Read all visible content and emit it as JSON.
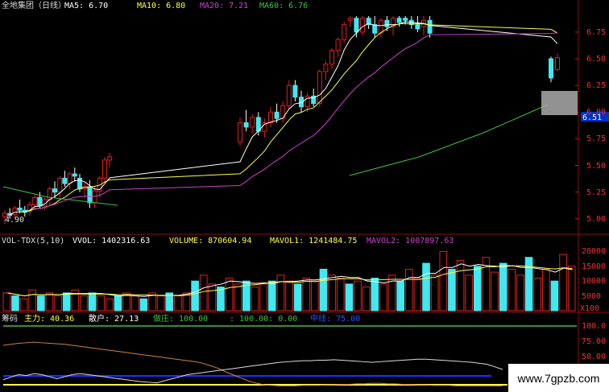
{
  "app": {
    "title": "全地集团（日线）",
    "colors": {
      "up": "#e02020",
      "down": "#40e8f0",
      "ma5": "#ffffff",
      "ma10": "#ffff40",
      "ma20": "#d040d0",
      "ma60": "#40c040",
      "axis": "#c02020"
    }
  },
  "price_panel": {
    "ma5": "MA5: 6.70",
    "ma10": "MA10: 6.80",
    "ma20": "MA20: 7.21",
    "ma60": "MA60: 6.76",
    "ticks": [
      "6.75",
      "6.50",
      "6.25",
      "6.00",
      "5.75",
      "5.50",
      "5.25",
      "5.00"
    ],
    "current_price": "6.51",
    "low_marker": "4.90"
  },
  "volume_panel": {
    "header": "VOL-TDX(5,10)",
    "vvol": "VVOL: 1402316.63",
    "volume": "VOLUME: 870604.94",
    "mavol1": "MAVOL1: 1241484.75",
    "mavol2": "MAVOL2: 1007897.63",
    "ticks": [
      "20000",
      "15000",
      "10000",
      "5000"
    ],
    "unit": "X100"
  },
  "indicator_panel": {
    "name": "筹码",
    "zhuli": "主力: 40.36",
    "sanhu": "散户: 27.13",
    "zhuang": "做庄: 100.00",
    "value": ": 100.00: 0.00",
    "zhongxian": "中线: 75.00",
    "ticks": [
      "100.0",
      "75.00",
      "50.00"
    ]
  },
  "watermark": "www.7gpzb.com",
  "chart_data": {
    "type": "candlestick",
    "ylim": [
      4.9,
      6.9
    ],
    "candles": [
      {
        "o": 5.02,
        "h": 5.08,
        "l": 4.95,
        "c": 5.05
      },
      {
        "o": 5.05,
        "h": 5.1,
        "l": 5.0,
        "c": 5.03
      },
      {
        "o": 5.04,
        "h": 5.12,
        "l": 5.0,
        "c": 5.1
      },
      {
        "o": 5.1,
        "h": 5.18,
        "l": 5.05,
        "c": 5.08
      },
      {
        "o": 5.08,
        "h": 5.12,
        "l": 5.02,
        "c": 5.06
      },
      {
        "o": 5.07,
        "h": 5.16,
        "l": 5.03,
        "c": 5.13
      },
      {
        "o": 5.13,
        "h": 5.22,
        "l": 5.08,
        "c": 5.2
      },
      {
        "o": 5.2,
        "h": 5.25,
        "l": 5.1,
        "c": 5.12
      },
      {
        "o": 5.12,
        "h": 5.2,
        "l": 5.08,
        "c": 5.18
      },
      {
        "o": 5.18,
        "h": 5.3,
        "l": 5.12,
        "c": 5.28
      },
      {
        "o": 5.28,
        "h": 5.35,
        "l": 5.2,
        "c": 5.25
      },
      {
        "o": 5.25,
        "h": 5.4,
        "l": 5.2,
        "c": 5.38
      },
      {
        "o": 5.38,
        "h": 5.45,
        "l": 5.3,
        "c": 5.33
      },
      {
        "o": 5.33,
        "h": 5.44,
        "l": 5.28,
        "c": 5.42
      },
      {
        "o": 5.42,
        "h": 5.48,
        "l": 5.35,
        "c": 5.4
      },
      {
        "o": 5.38,
        "h": 5.42,
        "l": 5.25,
        "c": 5.28
      },
      {
        "o": 5.28,
        "h": 5.35,
        "l": 5.2,
        "c": 5.3
      },
      {
        "o": 5.3,
        "h": 5.36,
        "l": 5.1,
        "c": 5.15
      },
      {
        "o": 5.15,
        "h": 5.3,
        "l": 5.1,
        "c": 5.26
      },
      {
        "o": 5.26,
        "h": 5.4,
        "l": 5.2,
        "c": 5.38
      },
      {
        "o": 5.38,
        "h": 5.58,
        "l": 5.34,
        "c": 5.55
      },
      {
        "o": 5.55,
        "h": 5.62,
        "l": 5.48,
        "c": 5.58
      },
      {
        "o": 5.72,
        "h": 5.95,
        "l": 5.68,
        "c": 5.9
      },
      {
        "o": 5.9,
        "h": 6.02,
        "l": 5.82,
        "c": 5.86
      },
      {
        "o": 5.86,
        "h": 5.98,
        "l": 5.8,
        "c": 5.95
      },
      {
        "o": 5.95,
        "h": 6.0,
        "l": 5.78,
        "c": 5.82
      },
      {
        "o": 5.82,
        "h": 5.94,
        "l": 5.76,
        "c": 5.9
      },
      {
        "o": 5.9,
        "h": 6.05,
        "l": 5.86,
        "c": 6.0
      },
      {
        "o": 6.0,
        "h": 6.08,
        "l": 5.9,
        "c": 5.94
      },
      {
        "o": 5.94,
        "h": 6.1,
        "l": 5.9,
        "c": 6.06
      },
      {
        "o": 6.06,
        "h": 6.3,
        "l": 6.02,
        "c": 6.25
      },
      {
        "o": 6.25,
        "h": 6.3,
        "l": 6.1,
        "c": 6.14
      },
      {
        "o": 6.14,
        "h": 6.2,
        "l": 6.0,
        "c": 6.05
      },
      {
        "o": 6.05,
        "h": 6.18,
        "l": 6.0,
        "c": 6.15
      },
      {
        "o": 6.15,
        "h": 6.22,
        "l": 6.05,
        "c": 6.08
      },
      {
        "o": 6.08,
        "h": 6.4,
        "l": 6.05,
        "c": 6.38
      },
      {
        "o": 6.38,
        "h": 6.48,
        "l": 6.3,
        "c": 6.45
      },
      {
        "o": 6.45,
        "h": 6.6,
        "l": 6.4,
        "c": 6.58
      },
      {
        "o": 6.58,
        "h": 6.7,
        "l": 6.52,
        "c": 6.68
      },
      {
        "o": 6.68,
        "h": 6.85,
        "l": 6.65,
        "c": 6.82
      },
      {
        "o": 6.86,
        "h": 6.9,
        "l": 6.8,
        "c": 6.88
      },
      {
        "o": 6.88,
        "h": 6.9,
        "l": 6.7,
        "c": 6.75
      },
      {
        "o": 6.75,
        "h": 6.9,
        "l": 6.72,
        "c": 6.88
      },
      {
        "o": 6.88,
        "h": 6.9,
        "l": 6.78,
        "c": 6.82
      },
      {
        "o": 6.82,
        "h": 6.9,
        "l": 6.7,
        "c": 6.74
      },
      {
        "o": 6.74,
        "h": 6.88,
        "l": 6.7,
        "c": 6.86
      },
      {
        "o": 6.86,
        "h": 6.9,
        "l": 6.76,
        "c": 6.8
      },
      {
        "o": 6.8,
        "h": 6.9,
        "l": 6.72,
        "c": 6.88
      },
      {
        "o": 6.88,
        "h": 6.9,
        "l": 6.8,
        "c": 6.84
      },
      {
        "o": 6.88,
        "h": 6.9,
        "l": 6.82,
        "c": 6.86
      },
      {
        "o": 6.86,
        "h": 6.9,
        "l": 6.78,
        "c": 6.82
      },
      {
        "o": 6.82,
        "h": 6.9,
        "l": 6.75,
        "c": 6.78
      },
      {
        "o": 6.8,
        "h": 6.9,
        "l": 6.72,
        "c": 6.86
      },
      {
        "o": 6.86,
        "h": 6.9,
        "l": 6.7,
        "c": 6.74
      },
      {
        "o": 6.5,
        "h": 6.52,
        "l": 6.28,
        "c": 6.32
      },
      {
        "o": 6.4,
        "h": 6.55,
        "l": 6.38,
        "c": 6.51
      }
    ],
    "volume": [
      6,
      5,
      4,
      7,
      5,
      6,
      5,
      6,
      7,
      5,
      6,
      5,
      4,
      5,
      6,
      5,
      4,
      6,
      5,
      6,
      5,
      6,
      10,
      12,
      9,
      8,
      11,
      9,
      10,
      8,
      9,
      10,
      12,
      10,
      9,
      11,
      10,
      14,
      12,
      11,
      9,
      10,
      8,
      11,
      9,
      12,
      10,
      14,
      11,
      16,
      12,
      20,
      14,
      17,
      12,
      15,
      18,
      13,
      16,
      14,
      12,
      18,
      11,
      14,
      10,
      19,
      15
    ],
    "indicator_main": [
      80,
      82,
      84,
      85,
      86,
      85,
      84,
      83,
      82,
      80,
      78,
      76,
      74,
      72,
      70,
      68,
      66,
      64,
      62,
      60,
      58,
      56,
      54,
      52,
      50,
      48,
      45,
      40,
      35,
      28,
      22,
      16,
      10,
      6,
      3,
      2,
      1,
      1,
      1,
      2,
      2,
      2,
      3,
      3,
      4,
      4,
      5,
      5,
      6,
      6,
      5,
      5,
      4,
      4,
      3,
      3,
      2,
      2,
      2,
      1,
      1,
      1,
      1,
      1,
      1,
      1
    ],
    "indicator_retail": [
      60,
      65,
      70,
      68,
      72,
      70,
      66,
      62,
      66,
      70,
      72,
      70,
      68,
      66,
      64,
      62,
      60,
      58,
      56,
      55,
      54,
      58,
      62,
      66,
      70,
      72,
      74,
      76,
      78,
      80,
      82,
      84,
      86,
      88,
      90,
      92,
      94,
      95,
      96,
      97,
      97,
      98,
      98,
      99,
      98,
      97,
      96,
      95,
      94,
      95,
      96,
      97,
      98,
      99,
      100,
      100,
      99,
      98,
      97,
      96,
      95,
      94,
      92,
      90,
      85,
      80
    ]
  }
}
